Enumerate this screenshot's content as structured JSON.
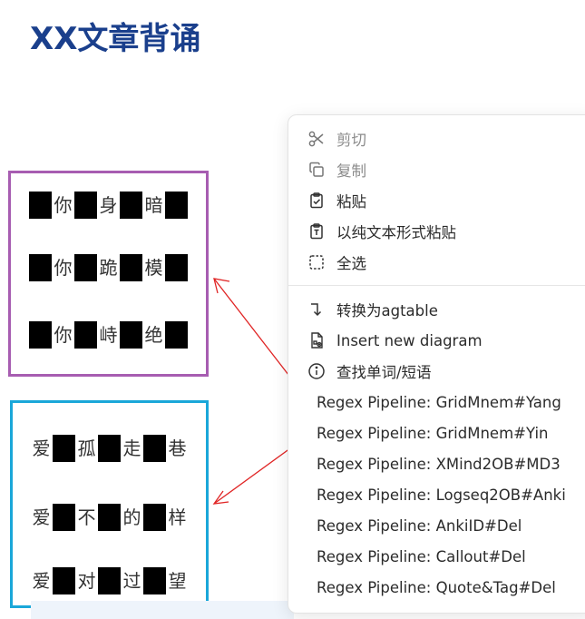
{
  "page": {
    "title": "XX文章背诵"
  },
  "purple_block": {
    "lines": [
      [
        "",
        "你",
        "",
        "身",
        "",
        "暗",
        ""
      ],
      [
        "",
        "你",
        "",
        "跪",
        "",
        "模",
        ""
      ],
      [
        "",
        "你",
        "",
        "峙",
        "",
        "绝",
        ""
      ]
    ]
  },
  "blue_block": {
    "lines": [
      [
        "爱",
        "",
        "孤",
        "",
        "走",
        "",
        "巷"
      ],
      [
        "爱",
        "",
        "不",
        "",
        "的",
        "",
        "样"
      ],
      [
        "爱",
        "",
        "对",
        "",
        "过",
        "",
        "望"
      ]
    ]
  },
  "context_menu": {
    "cut": "剪切",
    "copy": "复制",
    "paste": "粘贴",
    "paste_plain": "以纯文本形式粘贴",
    "select_all": "全选",
    "to_agtable": "转换为agtable",
    "insert_diagram": "Insert new diagram",
    "lookup": "查找单词/短语",
    "regex_items": [
      "Regex Pipeline: GridMnem#Yang",
      "Regex Pipeline: GridMnem#Yin",
      "Regex Pipeline: XMind2OB#MD3",
      "Regex Pipeline: Logseq2OB#Anki",
      "Regex Pipeline: AnkiID#Del",
      "Regex Pipeline: Callout#Del",
      "Regex Pipeline: Quote&Tag#Del"
    ]
  },
  "colors": {
    "title": "#1a3f8c",
    "purple_border": "#a75db1",
    "blue_border": "#1aa7d9",
    "arrow": "#e02424"
  }
}
